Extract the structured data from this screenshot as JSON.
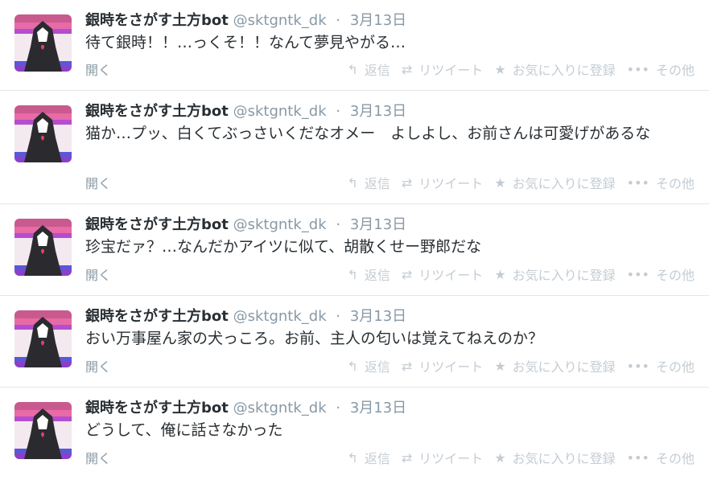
{
  "tweets": [
    {
      "name": "銀時をさがす土方bot",
      "handle": "@sktgntk_dk",
      "time": "3月13日",
      "text": "待て銀時！！…っくそ！！なんて夢見やがる…",
      "expand": "開く"
    },
    {
      "name": "銀時をさがす土方bot",
      "handle": "@sktgntk_dk",
      "time": "3月13日",
      "text": "猫か…プッ、白くてぶっさいくだなオメー　よしよし、お前さんは可愛げがあるな",
      "expand": "開く"
    },
    {
      "name": "銀時をさがす土方bot",
      "handle": "@sktgntk_dk",
      "time": "3月13日",
      "text": "珍宝だァ？…なんだかアイツに似て、胡散くせー野郎だな",
      "expand": "開く"
    },
    {
      "name": "銀時をさがす土方bot",
      "handle": "@sktgntk_dk",
      "time": "3月13日",
      "text": "おい万事屋ん家の犬っころ。お前、主人の匂いは覚えてねえのか？",
      "expand": "開く"
    },
    {
      "name": "銀時をさがす土方bot",
      "handle": "@sktgntk_dk",
      "time": "3月13日",
      "text": "どうして、俺に話さなかった",
      "expand": "開く"
    }
  ],
  "actions": {
    "reply": "返信",
    "retweet": "リツイート",
    "favorite": "お気に入りに登録",
    "more": "その他"
  },
  "icons": {
    "reply": "reply-arrow-icon",
    "retweet": "retweet-arrows-icon",
    "favorite": "star-icon",
    "more": "ellipsis-icon"
  },
  "colors": {
    "name": "#292f33",
    "meta": "#8899a6",
    "action": "#c4ccd3",
    "divider": "#e1e8ed"
  }
}
